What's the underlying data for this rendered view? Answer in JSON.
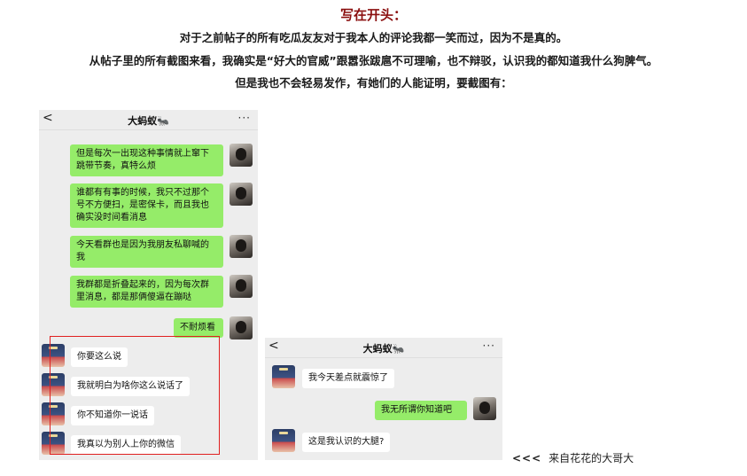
{
  "article": {
    "heading": "写在开头：",
    "paragraphs": [
      "对于之前帖子的所有吃瓜友友对于我本人的评论我都一笑而过，因为不是真的。",
      "从帖子里的所有截图来看，我确实是“好大的官威”跟嚣张跋扈不可理喻，也不辩驳，认识我的都知道我什么狗脾气。",
      "但是我也不会轻易发作，有她们的人能证明，要截图有："
    ]
  },
  "screenshot1": {
    "title": "大蚂蚁🐜",
    "back": "<",
    "more": "···",
    "messages": [
      {
        "side": "right",
        "text": "但是每次一出现这种事情就上窜下跳带节奏，真特么烦"
      },
      {
        "side": "right",
        "text": "谁都有有事的时候，我只不过那个号不方便扫，是密保卡，而且我也确实没时间看消息"
      },
      {
        "side": "right",
        "text": "今天看群也是因为我朋友私聊喊的我"
      },
      {
        "side": "right",
        "text": "我群都是折叠起来的，因为每次群里消息，都是那俩傻逼在蹦哒"
      },
      {
        "side": "right",
        "text": "不耐烦看"
      },
      {
        "side": "left",
        "text": "你要这么说"
      },
      {
        "side": "left",
        "text": "我就明白为啥你这么说话了"
      },
      {
        "side": "left",
        "text": "你不知道你一说话"
      },
      {
        "side": "left",
        "text": "我真以为别人上你的微信"
      }
    ]
  },
  "screenshot2": {
    "title": "大蚂蚁🐜",
    "back": "<",
    "more": "···",
    "messages": [
      {
        "side": "left",
        "text": "我今天差点就震惊了"
      },
      {
        "side": "right",
        "text": "我无所谓你知道吧"
      },
      {
        "side": "left",
        "text": "这是我认识的大腿?"
      }
    ]
  },
  "caption": {
    "arrows": "<<<",
    "text": "来自花花的大哥大"
  },
  "colors": {
    "heading": "#8b0f0f",
    "bubble_green": "#95ec69",
    "chat_bg": "#ededed",
    "highlight_box": "#e02020"
  }
}
